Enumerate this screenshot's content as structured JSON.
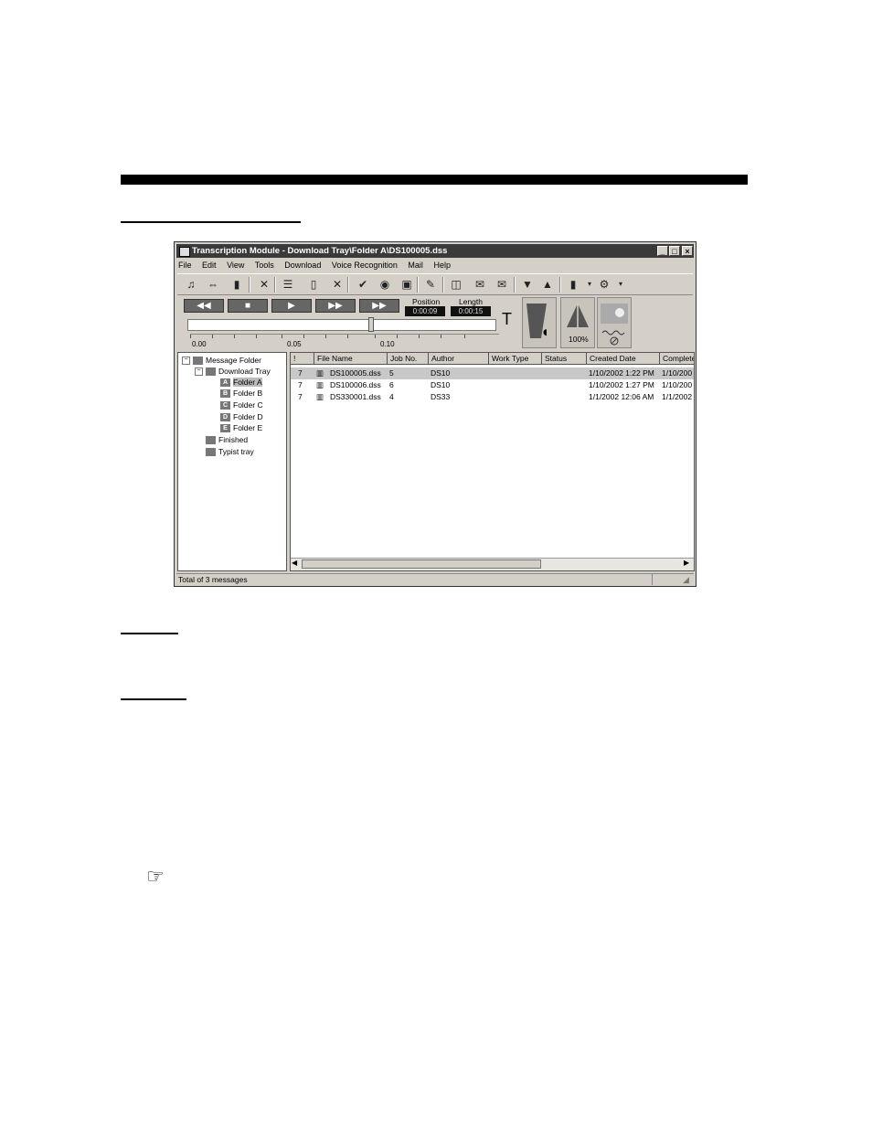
{
  "window": {
    "title": "Transcription Module - Download Tray\\Folder A\\DS100005.dss",
    "min": "_",
    "max": "□",
    "close": "×"
  },
  "menu": [
    "File",
    "Edit",
    "View",
    "Tools",
    "Download",
    "Voice Recognition",
    "Mail",
    "Help"
  ],
  "player": {
    "rewind": "◀◀",
    "stop": "■",
    "play": "▶",
    "ff": "▶▶",
    "next": "▶▶",
    "position_label": "Position",
    "position_value": "0:00:09",
    "length_label": "Length",
    "length_value": "0:00:15",
    "ruler_labels": [
      "0.00",
      "0.05",
      "0.10"
    ],
    "speed_value": "100%"
  },
  "tree": {
    "root": "Message Folder",
    "download_tray": "Download Tray",
    "folders": [
      "Folder A",
      "Folder B",
      "Folder C",
      "Folder D",
      "Folder E"
    ],
    "folder_letters": [
      "A",
      "B",
      "C",
      "D",
      "E"
    ],
    "finished": "Finished",
    "typist": "Typist tray"
  },
  "list": {
    "columns": [
      "!",
      "File Name",
      "Job No.",
      "Author",
      "Work Type",
      "Status",
      "Created Date",
      "Complete"
    ],
    "rows": [
      {
        "priority": "7",
        "file": "DS100005.dss",
        "job": "5",
        "author": "DS10",
        "created": "1/10/2002 1:22 PM",
        "completed": "1/10/200"
      },
      {
        "priority": "7",
        "file": "DS100006.dss",
        "job": "6",
        "author": "DS10",
        "created": "1/10/2002 1:27 PM",
        "completed": "1/10/200"
      },
      {
        "priority": "7",
        "file": "DS330001.dss",
        "job": "4",
        "author": "DS33",
        "created": "1/1/2002 12:06 AM",
        "completed": "1/1/2002"
      }
    ]
  },
  "status": {
    "text": "Total of 3 messages"
  },
  "icons": {
    "note": "☞"
  }
}
